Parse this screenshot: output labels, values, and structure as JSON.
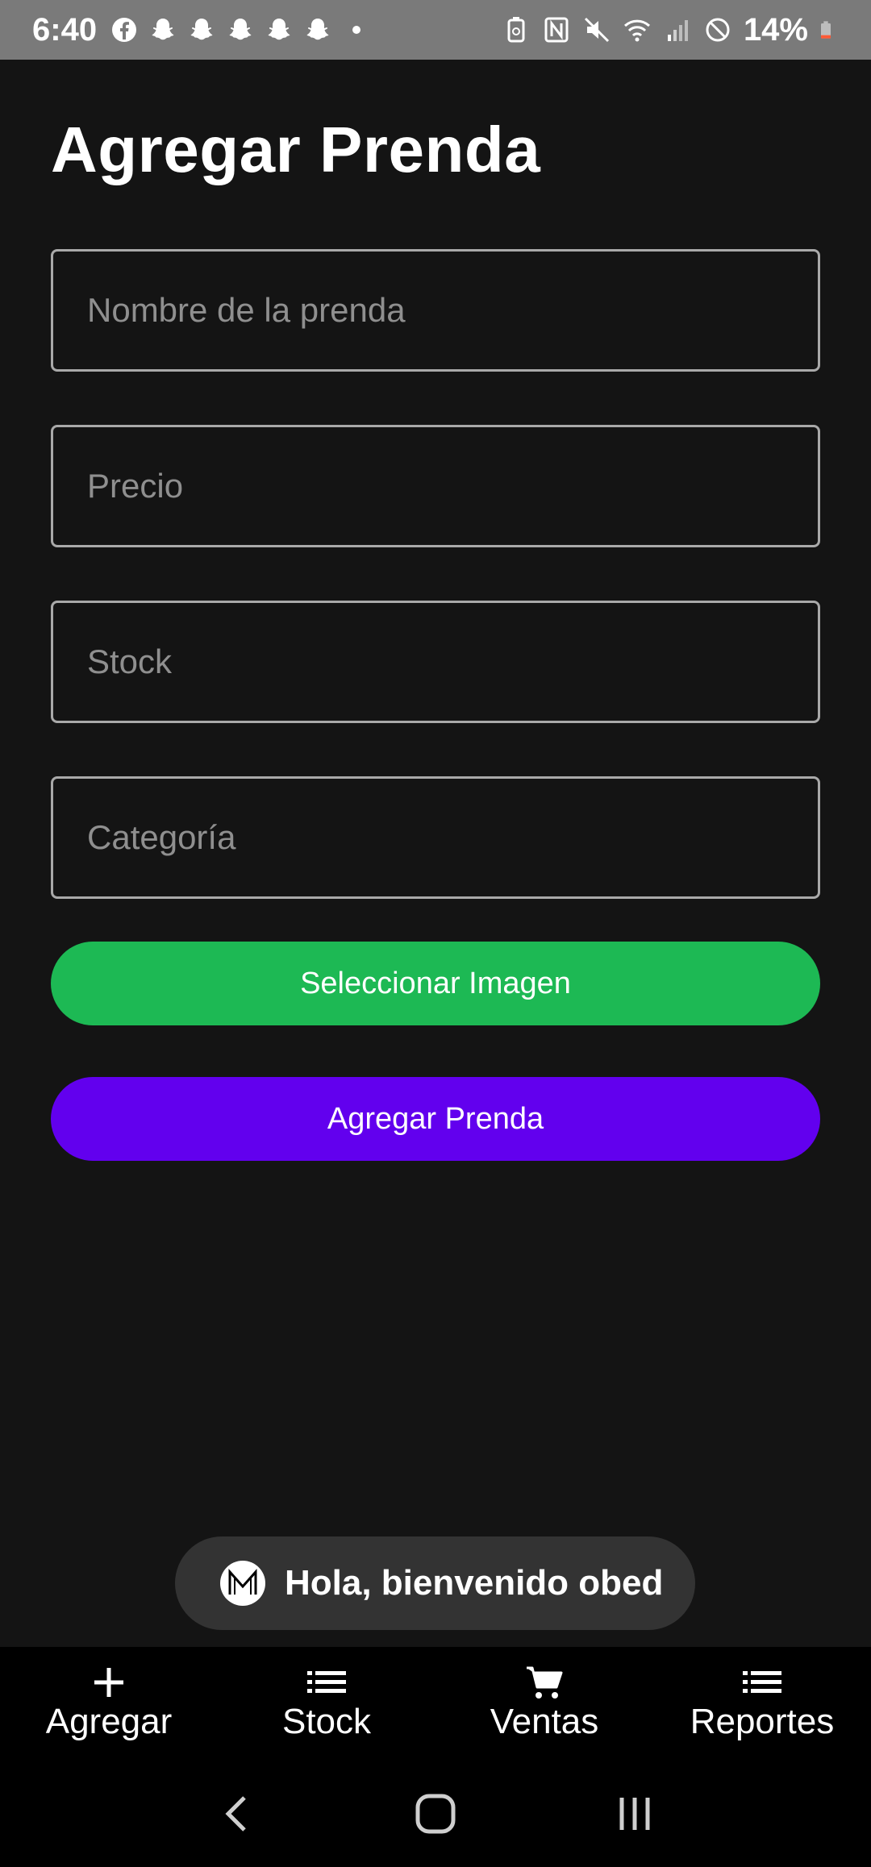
{
  "status_bar": {
    "time": "6:40",
    "battery_percent": "14%",
    "left_icons": [
      "facebook-icon",
      "snapchat-icon",
      "snapchat-icon",
      "snapchat-icon",
      "snapchat-icon",
      "snapchat-icon",
      "dot-icon"
    ],
    "right_icons": [
      "battery-saver-icon",
      "nfc-icon",
      "mute-icon",
      "wifi-icon",
      "signal-icon",
      "do-not-disturb-icon",
      "battery-icon"
    ]
  },
  "page": {
    "title": "Agregar Prenda"
  },
  "form": {
    "name_placeholder": "Nombre de la prenda",
    "price_placeholder": "Precio",
    "stock_placeholder": "Stock",
    "category_placeholder": "Categoría",
    "select_image_label": "Seleccionar Imagen",
    "submit_label": "Agregar Prenda"
  },
  "toast": {
    "message": "Hola, bienvenido obed"
  },
  "bottom_nav": {
    "items": [
      {
        "label": "Agregar",
        "icon": "plus-icon"
      },
      {
        "label": "Stock",
        "icon": "list-icon"
      },
      {
        "label": "Ventas",
        "icon": "cart-icon"
      },
      {
        "label": "Reportes",
        "icon": "list-icon"
      }
    ]
  },
  "colors": {
    "background": "#141414",
    "status_bar": "#7a7a7a",
    "green_button": "#1db954",
    "purple_button": "#6200ee",
    "toast": "#333333",
    "nav": "#000000"
  }
}
